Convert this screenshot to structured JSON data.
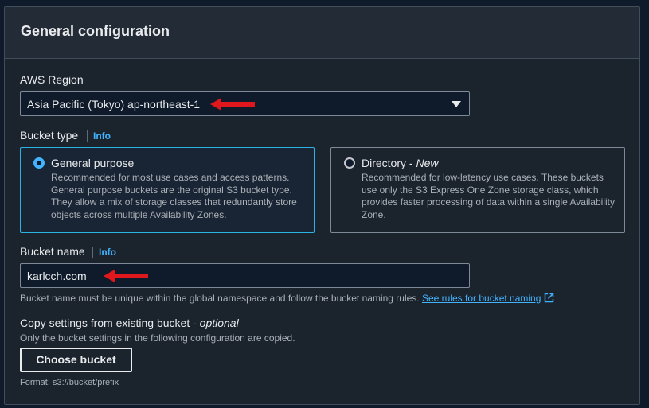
{
  "panel": {
    "title": "General configuration"
  },
  "region": {
    "label": "AWS Region",
    "selected": "Asia Pacific (Tokyo) ap-northeast-1"
  },
  "bucket_type": {
    "label": "Bucket type",
    "info": "Info",
    "options": [
      {
        "title": "General purpose",
        "title_suffix": "",
        "selected": true,
        "description": "Recommended for most use cases and access patterns. General purpose buckets are the original S3 bucket type. They allow a mix of storage classes that redundantly store objects across multiple Availability Zones."
      },
      {
        "title": "Directory - ",
        "title_suffix": "New",
        "selected": false,
        "description": "Recommended for low-latency use cases. These buckets use only the S3 Express One Zone storage class, which provides faster processing of data within a single Availability Zone."
      }
    ]
  },
  "bucket_name": {
    "label": "Bucket name",
    "info": "Info",
    "value": "karlcch.com",
    "hint": "Bucket name must be unique within the global namespace and follow the bucket naming rules.",
    "hint_link": "See rules for bucket naming"
  },
  "copy_settings": {
    "label": "Copy settings from existing bucket - ",
    "label_optional": "optional",
    "description": "Only the bucket settings in the following configuration are copied.",
    "button": "Choose bucket",
    "format": "Format: s3://bucket/prefix"
  },
  "colors": {
    "accent": "#42b4ff",
    "selected_border": "#2bb3e4",
    "annotation_arrow": "#e0171d",
    "panel_bg": "#1b232d"
  },
  "icons": {
    "dropdown": "caret-down-icon",
    "external_link": "external-link-icon",
    "annotation": "red-arrow-icon"
  }
}
